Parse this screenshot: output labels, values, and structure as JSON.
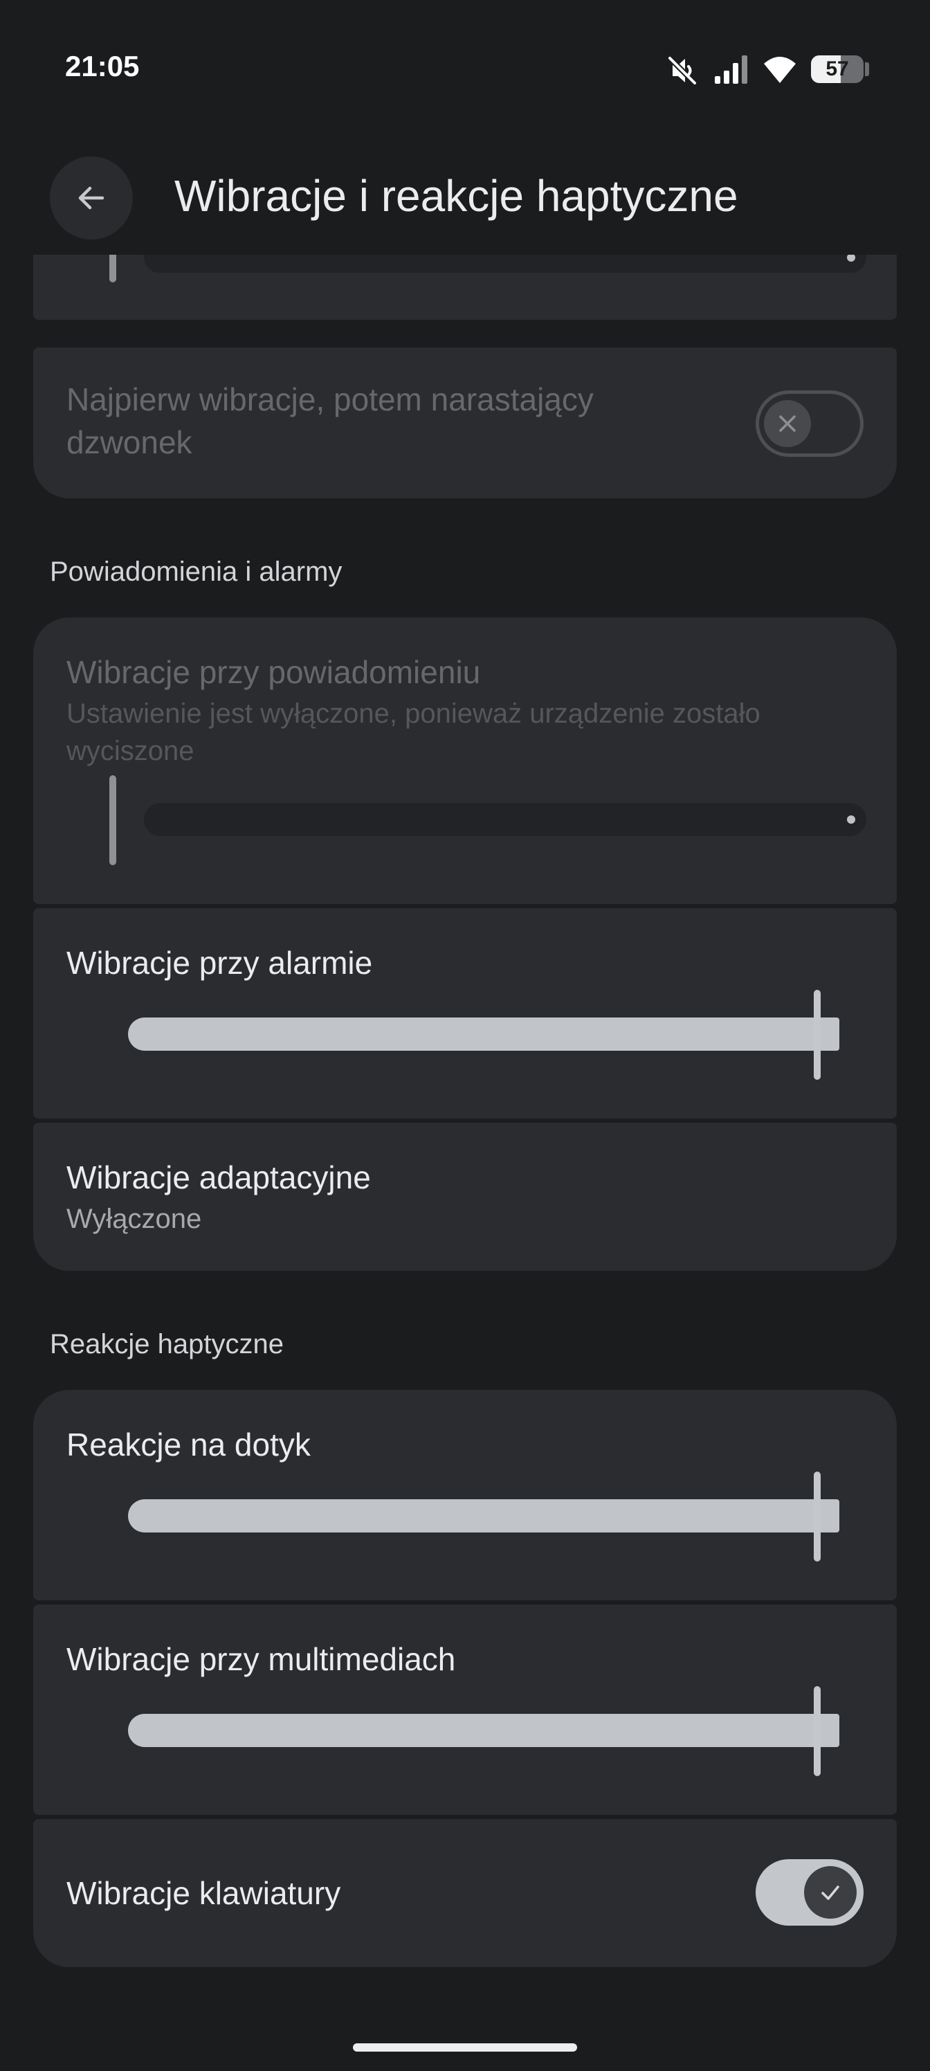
{
  "status_bar": {
    "time": "21:05",
    "battery_percent": "57",
    "battery_level": 0.57,
    "icons": [
      "vibrate-mute-icon",
      "cell-signal-icon",
      "wifi-icon",
      "battery-icon"
    ]
  },
  "app_bar": {
    "title": "Wibracje i reakcje haptyczne",
    "back_icon": "arrow-back-icon"
  },
  "ring_section": {
    "ring_slider": {
      "level": 0.0,
      "enabled": false
    },
    "ramping_ringer": {
      "label": "Najpierw wibracje, potem narastający dzwonek",
      "checked": false,
      "enabled": false
    }
  },
  "notifications_section": {
    "header": "Powiadomienia i alarmy",
    "notification_vibration": {
      "label": "Wibracje przy powiadomieniu",
      "summary": "Ustawienie jest wyłączone, ponieważ urządzenie zostało wyciszone",
      "level": 0.0,
      "enabled": false
    },
    "alarm_vibration": {
      "label": "Wibracje przy alarmie",
      "level": 1.0
    },
    "adaptive_vibration": {
      "label": "Wibracje adaptacyjne",
      "summary": "Wyłączone"
    }
  },
  "haptics_section": {
    "header": "Reakcje haptyczne",
    "touch_feedback": {
      "label": "Reakcje na dotyk",
      "level": 1.0
    },
    "media_vibration": {
      "label": "Wibracje przy multimediach",
      "level": 1.0
    },
    "keyboard_vibration": {
      "label": "Wibracje klawiatury",
      "checked": true
    }
  },
  "colors": {
    "background": "#1b1c1e",
    "card": "#2b2c2f",
    "slider_active": "#c1c5ca",
    "slider_inactive": "#222326",
    "text_primary": "#ececee",
    "text_disabled": "#66686b"
  }
}
